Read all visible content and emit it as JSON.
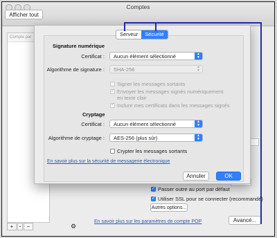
{
  "window": {
    "title": "Comptes"
  },
  "toolbar": {
    "show_all": "Afficher tout"
  },
  "sidebar": {
    "header": "Compte par",
    "add": "+",
    "add_menu": "⌄",
    "remove": "−",
    "gear": "⚙"
  },
  "background": {
    "options": [
      {
        "label": "Passer outre au port par défaut",
        "checked": true
      },
      {
        "label": "Utiliser SSL pour se connecter (recommandé)",
        "checked": true
      }
    ],
    "more_options": "Autres options...",
    "pop_link": "En savoir plus sur les paramètres de compte POP",
    "advanced": "Avancé..."
  },
  "sheet": {
    "tabs": [
      "Serveur",
      "Sécurité"
    ],
    "active_tab": "Sécurité",
    "signature": {
      "heading": "Signature numérique",
      "certificate_label": "Certificat :",
      "certificate_value": "Aucun élément sélectionné",
      "algorithm_label": "Algorithme de signature :",
      "algorithm_value": "SHA-256",
      "options": [
        {
          "label": "Signer les messages sortants",
          "checked": false
        },
        {
          "label": "Envoyer les messages signés numériquement",
          "label2": "en texte clair",
          "checked": true
        },
        {
          "label": "Inclure mes certificats dans les messages signés",
          "checked": true
        }
      ]
    },
    "encryption": {
      "heading": "Cryptage",
      "certificate_label": "Certificat :",
      "certificate_value": "Aucun élément sélectionné",
      "algorithm_label": "Algorithme de cryptage :",
      "algorithm_value": "AES-256 (plus sûr)",
      "encrypt_label": "Crypter les messages sortants",
      "encrypt_checked": false
    },
    "learn_more": "En savoir plus sur la sécurité de messagerie électronique",
    "cancel": "Annuler",
    "ok": "OK"
  },
  "colors": {
    "accent": "#2f80ff",
    "annotation": "#1f2aa8"
  }
}
